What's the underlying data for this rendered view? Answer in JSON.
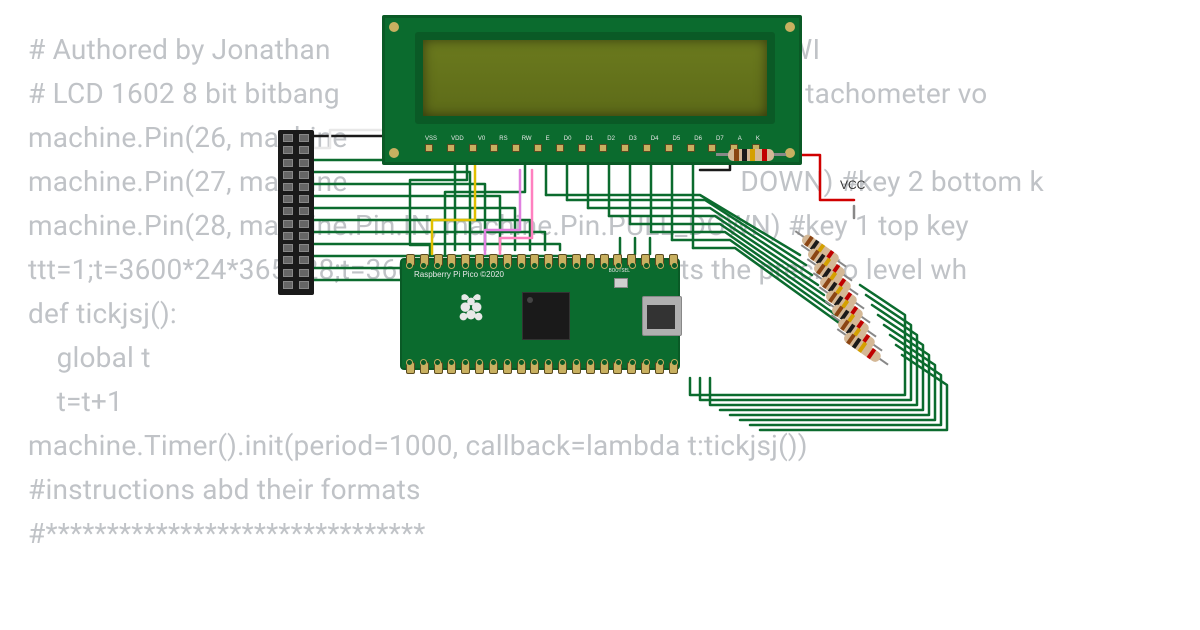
{
  "code_lines": [
    "# Authored by Jonathan                                                          'OKWI",
    "# LCD 1602 8 bit bitbang                                              ace as car tachometer vo",
    "machine.Pin(26, machine",
    "machine.Pin(27, machine                                                       DOWN) #key 2 bottom k",
    "machine.Pin(28, machine.Pin.IN, machine.Pin.PULL_DOWN) #key 1 top key",
    "ttt=1;t=3600*24*365+28;t=3600*24*2-9 # python sets the precisio level wh",
    "def tickjsj():",
    "    global t",
    "    t=t+1",
    "machine.Timer().init(period=1000, callback=lambda t:tickjsj())",
    "#instructions abd their formats",
    "#*******************************"
  ],
  "lcd": {
    "pin_labels": [
      "VSS",
      "VDD",
      "V0",
      "RS",
      "RW",
      "E",
      "D0",
      "D1",
      "D2",
      "D3",
      "D4",
      "D5",
      "D6",
      "D7",
      "A",
      "K"
    ]
  },
  "pico": {
    "label": "Raspberry Pi Pico ©2020",
    "bootsel": "BOOTSEL",
    "pin_count": 20
  },
  "header_rows": 13,
  "vcc_label": "VCC",
  "resistor_array_count": 8,
  "wire_colors": {
    "green": "#0b6b2e",
    "black": "#1a1a1a",
    "white": "#e8e8e8",
    "yellow": "#e0c000",
    "red": "#d00000",
    "blue": "#2020b0",
    "violet": "#e080e0",
    "gray": "#888888"
  }
}
